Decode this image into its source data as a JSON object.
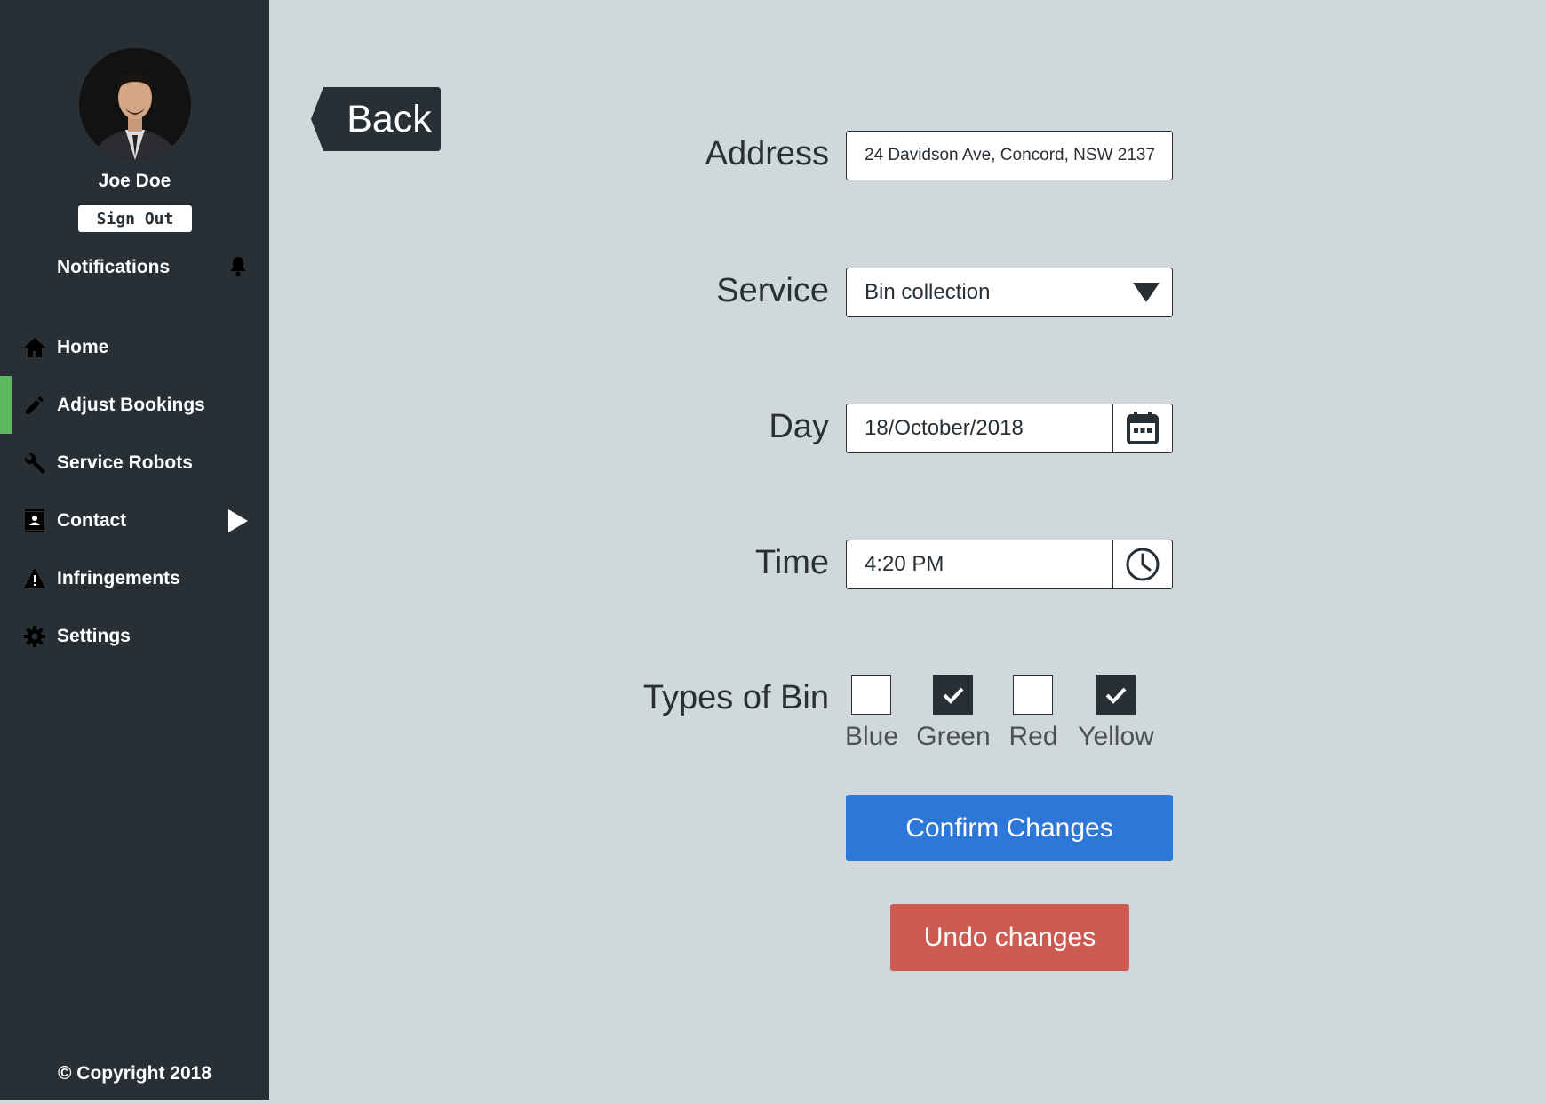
{
  "sidebar": {
    "user_name": "Joe Doe",
    "sign_out_label": "Sign Out",
    "notifications_label": "Notifications",
    "nav_items": [
      {
        "label": "Home",
        "icon": "home-icon"
      },
      {
        "label": "Adjust Bookings",
        "icon": "pencil-icon",
        "active": true
      },
      {
        "label": "Service Robots",
        "icon": "wrench-icon"
      },
      {
        "label": "Contact",
        "icon": "contact-book-icon"
      },
      {
        "label": "Infringements",
        "icon": "warning-icon"
      },
      {
        "label": "Settings",
        "icon": "gear-icon"
      }
    ],
    "copyright": "© Copyright 2018"
  },
  "back_label": "Back",
  "form": {
    "address": {
      "label": "Address",
      "value": "24 Davidson Ave, Concord, NSW 2137"
    },
    "service": {
      "label": "Service",
      "value": "Bin collection"
    },
    "day": {
      "label": "Day",
      "value": "18/October/2018"
    },
    "time": {
      "label": "Time",
      "value": "4:20 PM"
    },
    "bins": {
      "label": "Types of Bin",
      "options": [
        {
          "label": "Blue",
          "checked": false
        },
        {
          "label": "Green",
          "checked": true
        },
        {
          "label": "Red",
          "checked": false
        },
        {
          "label": "Yellow",
          "checked": true
        }
      ]
    },
    "confirm_label": "Confirm Changes",
    "undo_label": "Undo changes"
  },
  "colors": {
    "sidebar_bg": "#282f35",
    "page_bg": "#d1d8dc",
    "active_indicator": "#5cb85c",
    "confirm": "#2c77d7",
    "undo": "#cc5b53"
  }
}
